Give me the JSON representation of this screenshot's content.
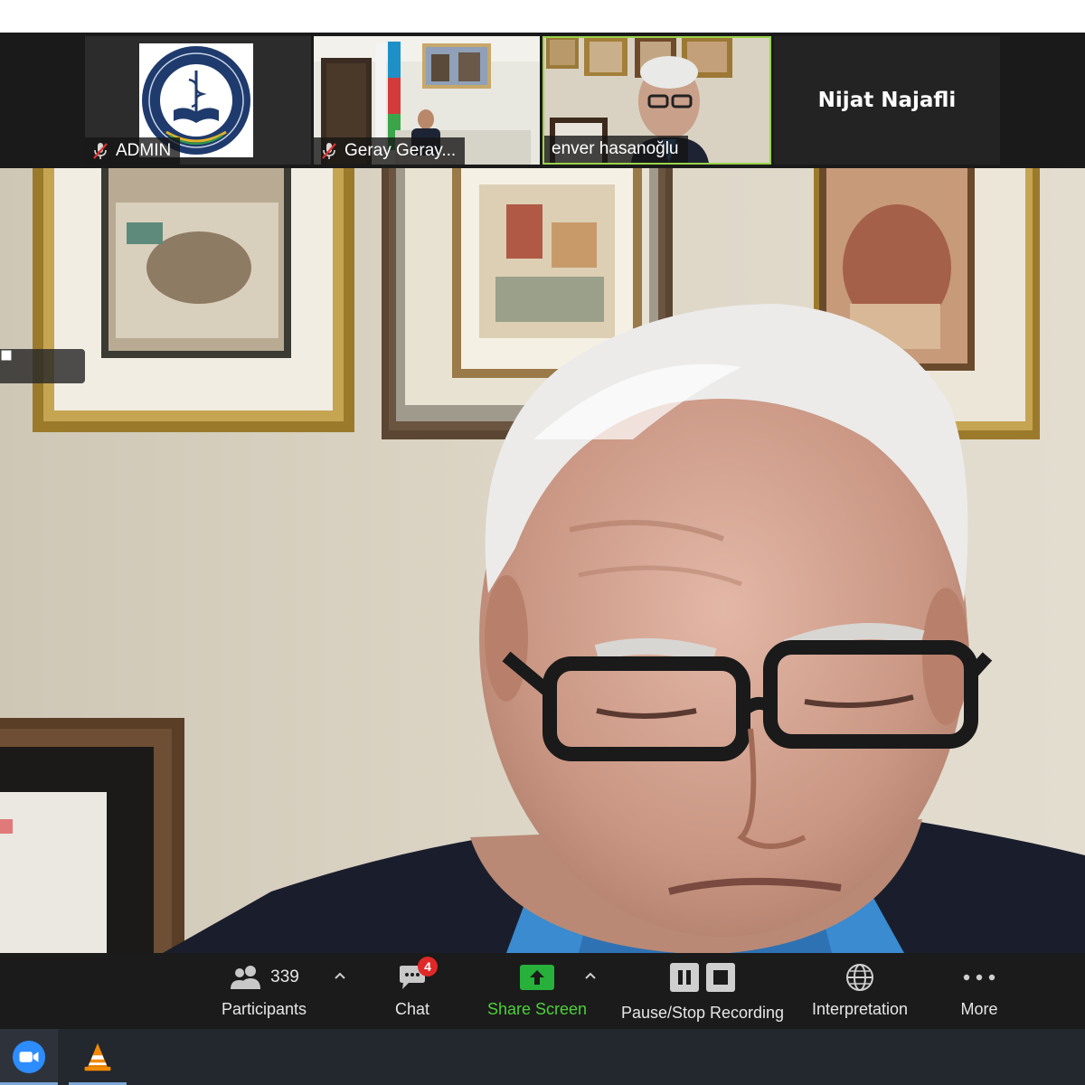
{
  "participants_strip": {
    "tiles": [
      {
        "name": "ADMIN",
        "muted": true,
        "kind": "logo"
      },
      {
        "name": "Geray Geray...",
        "muted": true,
        "kind": "video"
      },
      {
        "name": "enver hasanoğlu",
        "muted": false,
        "kind": "video",
        "active_speaker": true
      },
      {
        "name": "Nijat Najafli",
        "kind": "name-only"
      }
    ]
  },
  "recording_controls": {
    "pause_icon": "pause-icon",
    "stop_icon": "stop-icon"
  },
  "toolbar": {
    "participants": {
      "label": "Participants",
      "count": "339",
      "icon": "participants-icon"
    },
    "chat": {
      "label": "Chat",
      "badge": "4",
      "icon": "chat-icon"
    },
    "share": {
      "label": "Share Screen",
      "icon": "share-screen-icon",
      "color": "#4cd137"
    },
    "record": {
      "label": "Pause/Stop Recording",
      "icon": "pause-stop-icon"
    },
    "interpretation": {
      "label": "Interpretation",
      "icon": "globe-icon"
    },
    "more": {
      "label": "More",
      "icon": "more-icon"
    }
  },
  "taskbar": {
    "items": [
      {
        "icon": "zoom-app-icon",
        "color": "#2d8cff"
      },
      {
        "icon": "vlc-icon",
        "color": "#f28a00"
      }
    ]
  },
  "colors": {
    "active_speaker_border": "#9bd34a",
    "chat_badge": "#e02828",
    "share_accent": "#4cd137"
  }
}
